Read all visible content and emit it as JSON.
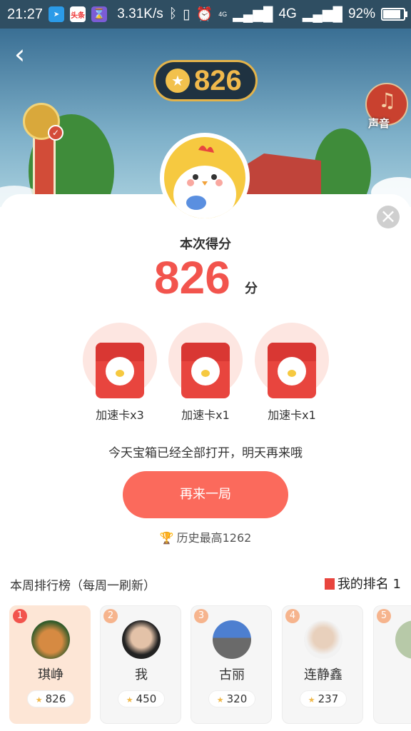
{
  "status_bar": {
    "time": "21:27",
    "app2_label": "头条",
    "network_speed": "3.31K/s",
    "network_type": "4G",
    "network_mini": "4G",
    "battery": "92%",
    "battery_level": 0.92
  },
  "game": {
    "coin_score": "826",
    "sound_label": "声音"
  },
  "result": {
    "score_label": "本次得分",
    "score_value": "826",
    "score_unit": "分"
  },
  "rewards": [
    {
      "label": "加速卡x3"
    },
    {
      "label": "加速卡x1"
    },
    {
      "label": "加速卡x1"
    }
  ],
  "notice": "今天宝箱已经全部打开，明天再来哦",
  "play_again": "再来一局",
  "history_best": "历史最高1262",
  "ranking": {
    "title": "本周排行榜（每周一刷新）",
    "my_rank_label": "我的排名 1",
    "entries": [
      {
        "rank": "1",
        "name": "琪峥",
        "score": "826"
      },
      {
        "rank": "2",
        "name": "我",
        "score": "450"
      },
      {
        "rank": "3",
        "name": "古丽",
        "score": "320"
      },
      {
        "rank": "4",
        "name": "连静鑫",
        "score": "237"
      },
      {
        "rank": "5",
        "name": "",
        "score": ""
      }
    ]
  },
  "colors": {
    "accent": "#f2544d",
    "button": "#fb6a5c",
    "gold": "#f0b94c"
  }
}
